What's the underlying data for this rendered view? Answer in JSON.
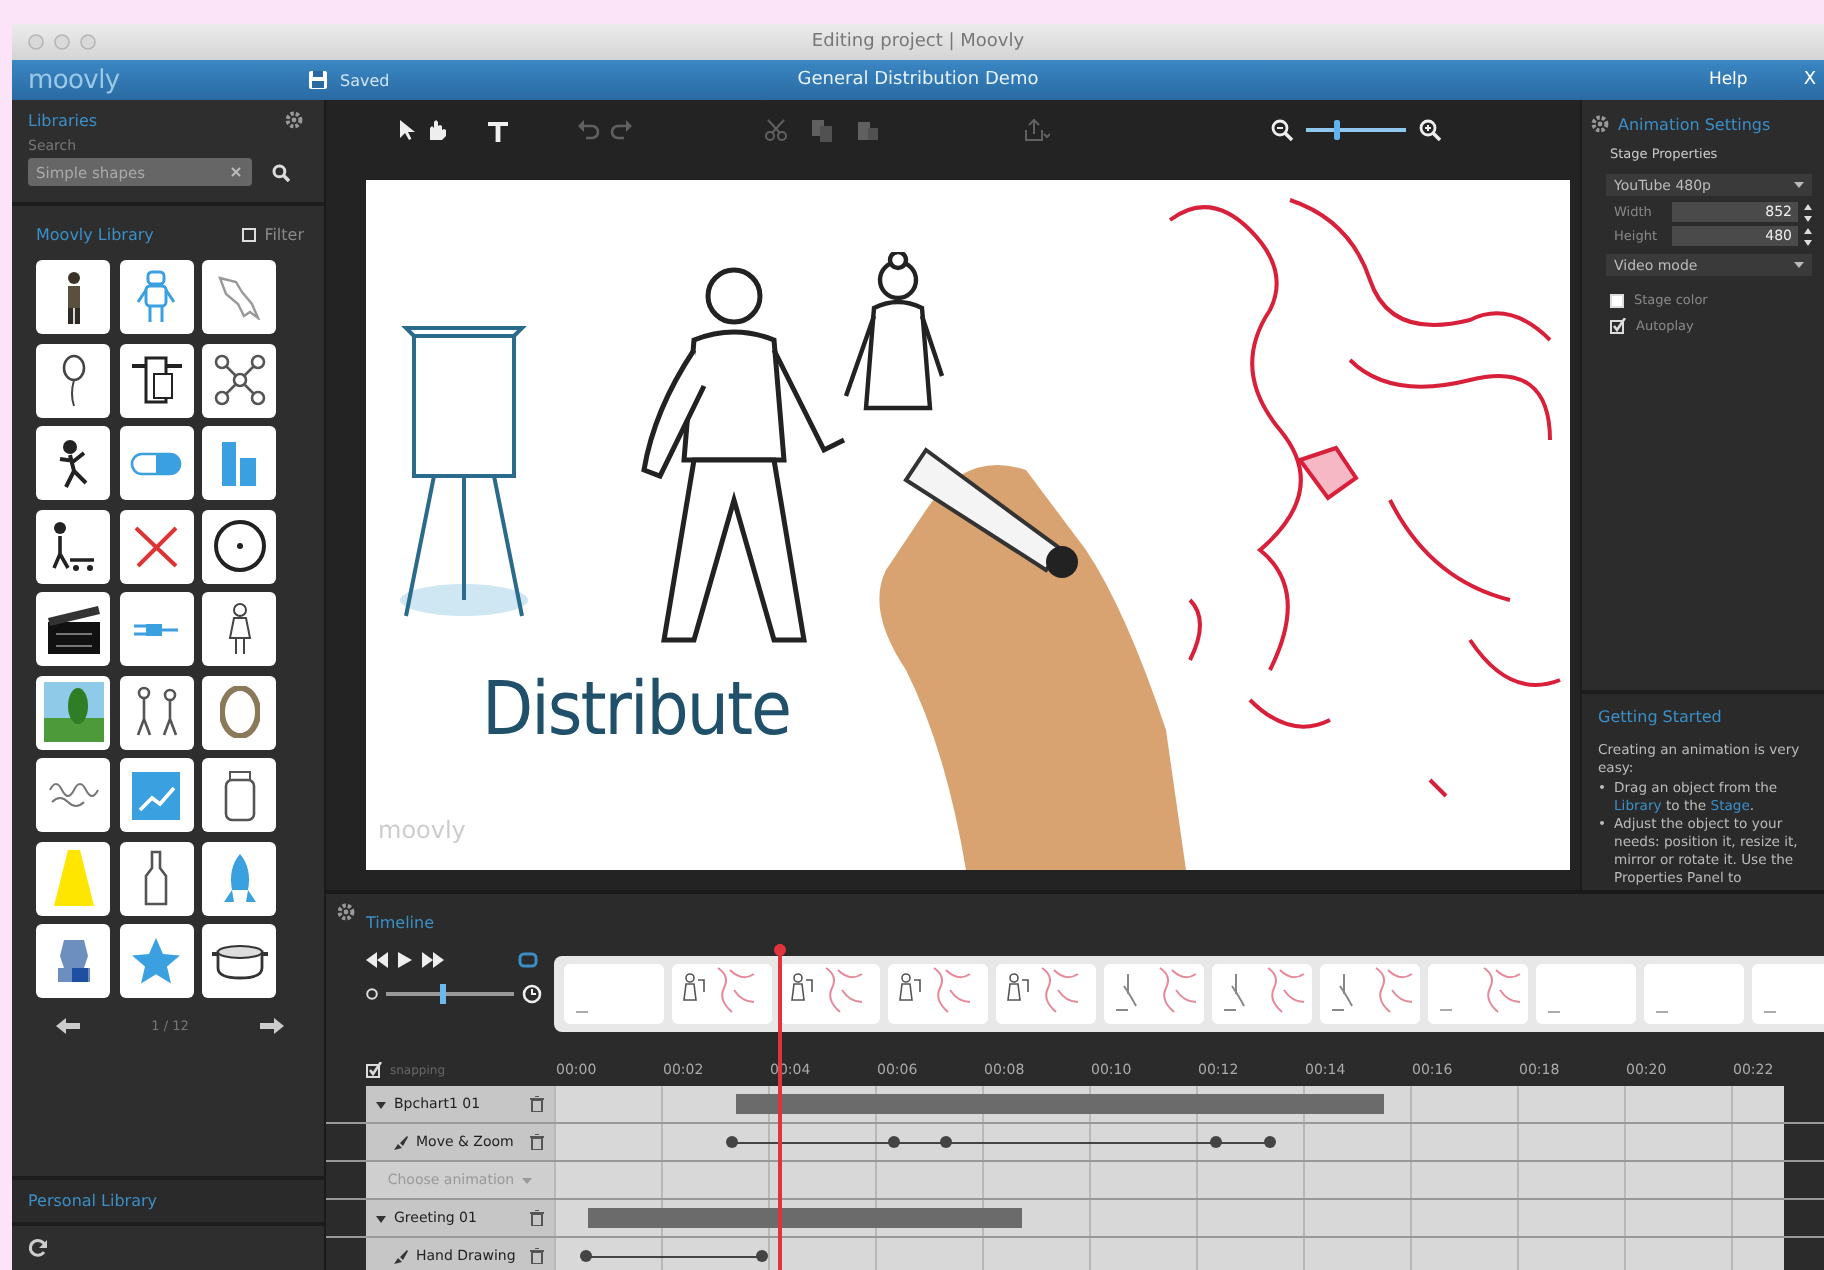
{
  "window": {
    "title": "Editing project | Moovly"
  },
  "app_bar": {
    "logo": "moovly",
    "save_status": "Saved",
    "project_title": "General Distribution Demo",
    "help": "Help",
    "close": "X"
  },
  "libraries": {
    "title": "Libraries",
    "search_label": "Search",
    "search": {
      "placeholder": "Simple shapes"
    }
  },
  "moovly_library": {
    "title": "Moovly Library",
    "filter": {
      "label": "Filter",
      "checked": false
    },
    "items": [
      {
        "kind": "person"
      },
      {
        "kind": "robot"
      },
      {
        "kind": "map"
      },
      {
        "kind": "balloon"
      },
      {
        "kind": "device"
      },
      {
        "kind": "atom"
      },
      {
        "kind": "runner"
      },
      {
        "kind": "pill"
      },
      {
        "kind": "buildings"
      },
      {
        "kind": "cart-kid"
      },
      {
        "kind": "cross"
      },
      {
        "kind": "wheel"
      },
      {
        "kind": "clapper"
      },
      {
        "kind": "plug"
      },
      {
        "kind": "figure"
      },
      {
        "kind": "tree"
      },
      {
        "kind": "walkers"
      },
      {
        "kind": "ring"
      },
      {
        "kind": "scribble"
      },
      {
        "kind": "chart"
      },
      {
        "kind": "jar"
      },
      {
        "kind": "light"
      },
      {
        "kind": "bottle"
      },
      {
        "kind": "rocket"
      },
      {
        "kind": "statue"
      },
      {
        "kind": "star"
      },
      {
        "kind": "pot"
      }
    ],
    "pagination": "1 / 12"
  },
  "personal_library": {
    "title": "Personal Library"
  },
  "toolbar": {
    "tools": [
      {
        "kind": "select",
        "disabled": false
      },
      {
        "kind": "hand",
        "disabled": false
      },
      {
        "kind": "text",
        "disabled": false
      },
      {
        "kind": "undo",
        "disabled": true
      },
      {
        "kind": "redo",
        "disabled": true
      },
      {
        "kind": "cut",
        "disabled": true
      },
      {
        "kind": "copy",
        "disabled": true
      },
      {
        "kind": "paste",
        "disabled": true
      },
      {
        "kind": "export",
        "disabled": true
      }
    ],
    "zoom": {
      "level": 0.3
    }
  },
  "stage": {
    "caption": "Distribute",
    "watermark": "moovly"
  },
  "animation_settings": {
    "title": "Animation Settings",
    "section": "Stage Properties",
    "preset": "YouTube 480p",
    "width": {
      "label": "Width",
      "value": "852"
    },
    "height": {
      "label": "Height",
      "value": "480"
    },
    "mode": "Video mode",
    "options": [
      {
        "label": "Stage color",
        "checked": false
      },
      {
        "label": "Autoplay",
        "checked": true
      }
    ]
  },
  "getting_started": {
    "title": "Getting Started",
    "intro": "Creating an animation is very easy:",
    "steps": [
      {
        "bullet": "•",
        "parts": [
          {
            "kind": "text",
            "text": "Drag an object from the "
          },
          {
            "kind": "link",
            "text": "Library"
          },
          {
            "kind": "text",
            "text": " to the "
          },
          {
            "kind": "link",
            "text": "Stage"
          },
          {
            "kind": "text",
            "text": "."
          }
        ]
      },
      {
        "bullet": "•",
        "parts": [
          {
            "kind": "text",
            "text": "Adjust the object to your needs: position it, resize it, mirror or rotate it. Use the Properties Panel to"
          }
        ]
      }
    ]
  },
  "timeline": {
    "title": "Timeline",
    "speed": {
      "level": 0.45
    },
    "filmstrip": [
      {
        "kind": "empty"
      },
      {
        "kind": "people-map"
      },
      {
        "kind": "people-map"
      },
      {
        "kind": "people-map"
      },
      {
        "kind": "people-map"
      },
      {
        "kind": "hand-map"
      },
      {
        "kind": "hand-map"
      },
      {
        "kind": "hand-map"
      },
      {
        "kind": "map"
      },
      {
        "kind": "empty"
      },
      {
        "kind": "empty"
      },
      {
        "kind": "empty"
      }
    ],
    "snapping": {
      "label": "snapping",
      "checked": true
    },
    "ruler": [
      "00:00",
      "00:02",
      "00:04",
      "00:06",
      "00:08",
      "00:10",
      "00:12",
      "00:14",
      "00:16",
      "00:18",
      "00:20",
      "00:22"
    ],
    "playhead": {
      "level": 0.151
    },
    "tracks": [
      {
        "kind": "object",
        "label": "Bpchart1 01",
        "expanded": true
      },
      {
        "kind": "animation",
        "label": "Move & Zoom"
      },
      {
        "kind": "chooser",
        "label": "Choose animation"
      },
      {
        "kind": "object",
        "label": "Greeting 01",
        "expanded": true
      },
      {
        "kind": "animation",
        "label": "Hand Drawing"
      }
    ]
  }
}
